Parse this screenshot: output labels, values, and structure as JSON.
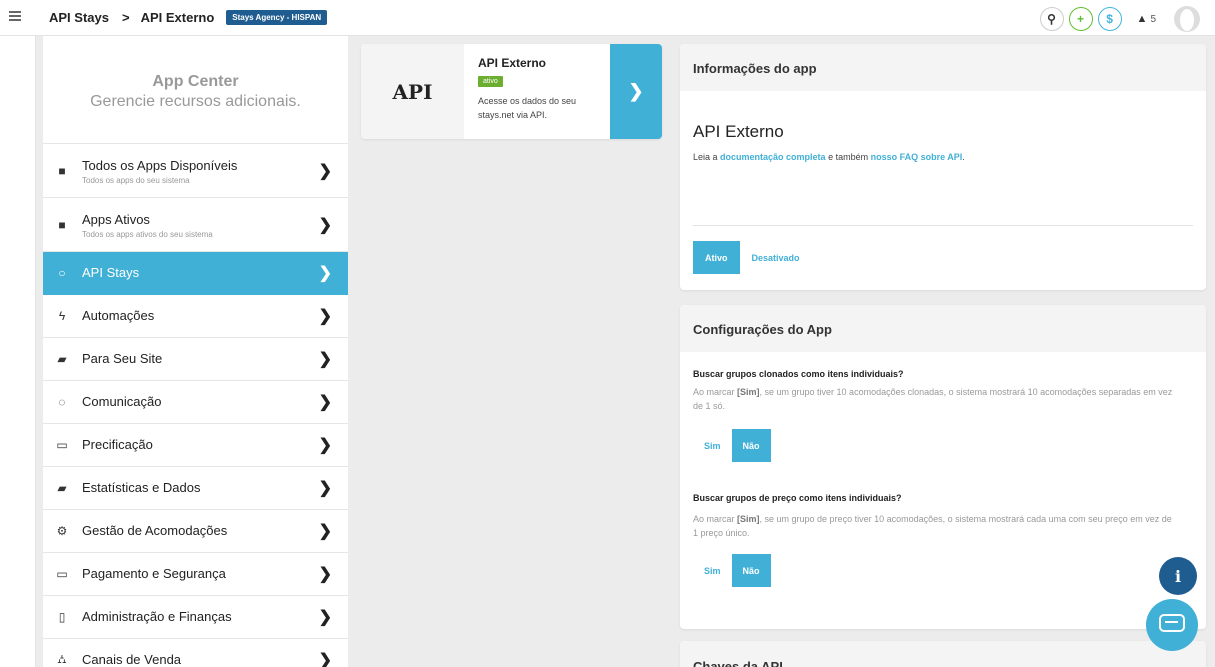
{
  "topbar": {
    "crumb1": "API Stays",
    "crumb_sep": ">",
    "crumb2": "API Externo",
    "agency": "Stays Agency - HISPAN",
    "currency_symbol": "$",
    "plus_symbol": "+",
    "search_symbol": "⚲",
    "alerts_count": "5"
  },
  "sidebar": {
    "title": "App Center",
    "subtitle": "Gerencie recursos adicionais.",
    "items": [
      {
        "label": "Todos os Apps Disponíveis",
        "sub": "Todos os apps do seu sistema",
        "icon": "folder-icon",
        "glyph": "■"
      },
      {
        "label": "Apps Ativos",
        "sub": "Todos os apps ativos do seu sistema",
        "icon": "folder-icon",
        "glyph": "■"
      },
      {
        "label": "API Stays",
        "icon": "github-icon",
        "glyph": "○"
      },
      {
        "label": "Automações",
        "icon": "bolt-icon",
        "glyph": "ϟ"
      },
      {
        "label": "Para Seu Site",
        "icon": "shopping-bag-icon",
        "glyph": "▰"
      },
      {
        "label": "Comunicação",
        "icon": "comments-icon",
        "glyph": "◌"
      },
      {
        "label": "Precificação",
        "icon": "money-bill-icon",
        "glyph": "▭"
      },
      {
        "label": "Estatísticas e Dados",
        "icon": "book-icon",
        "glyph": "▰"
      },
      {
        "label": "Gestão de Acomodações",
        "icon": "cogs-icon",
        "glyph": "⚙"
      },
      {
        "label": "Pagamento e Segurança",
        "icon": "credit-card-icon",
        "glyph": "▭"
      },
      {
        "label": "Administração e Finanças",
        "icon": "building-icon",
        "glyph": "▯"
      },
      {
        "label": "Canais de Venda",
        "icon": "sitemap-icon",
        "glyph": "⛼"
      }
    ],
    "chevron": "❯"
  },
  "app_card": {
    "logo_text": "API",
    "name": "API Externo",
    "status": "ativo",
    "description": "Acesse os dados do seu stays.net via API."
  },
  "info_panel": {
    "heading": "Informações do app",
    "app_name": "API Externo",
    "read_prefix": "Leia a ",
    "doc_link": "documentação completa",
    "read_middle": " e também ",
    "faq_link": "nosso FAQ sobre API",
    "read_suffix": ".",
    "toggle_on": "Ativo",
    "toggle_off": "Desativado"
  },
  "config_panel": {
    "heading": "Configurações do App",
    "q1": "Buscar grupos clonados como itens individuais?",
    "q1_prefix": "Ao marcar ",
    "q1_bold": "[Sim]",
    "q1_text": ", se um grupo tiver 10 acomodações clonadas, o sistema mostrará 10 acomodações separadas em vez de 1 só.",
    "q2": "Buscar grupos de preço como itens individuais?",
    "q2_prefix": "Ao marcar ",
    "q2_bold": "[Sim]",
    "q2_text": ", se um grupo de preço tiver 10 acomodações, o sistema mostrará cada uma com seu preço em vez de 1 preço único.",
    "yes": "Sim",
    "no": "Não"
  },
  "keys_panel": {
    "heading": "Chaves da API"
  },
  "colors": {
    "accent": "#41b0d6",
    "active_tag": "#6cae30",
    "agency_badge": "#1f5c8f"
  }
}
